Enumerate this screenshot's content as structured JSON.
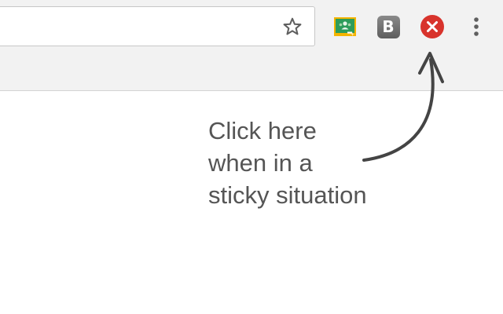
{
  "toolbar": {
    "bookmark_icon": "star-icon",
    "extensions": [
      {
        "icon": "google-classroom-icon",
        "color": "#2e8b57"
      },
      {
        "icon": "b-extension-icon",
        "label": "B",
        "color": "#707070"
      },
      {
        "icon": "close-circle-icon",
        "color": "#d93b34"
      }
    ],
    "menu_icon": "more-vert-icon"
  },
  "annotation": {
    "lines": [
      "Click here",
      "when in a",
      "sticky situation"
    ],
    "color": "#555555",
    "arrow_color": "#444444"
  }
}
